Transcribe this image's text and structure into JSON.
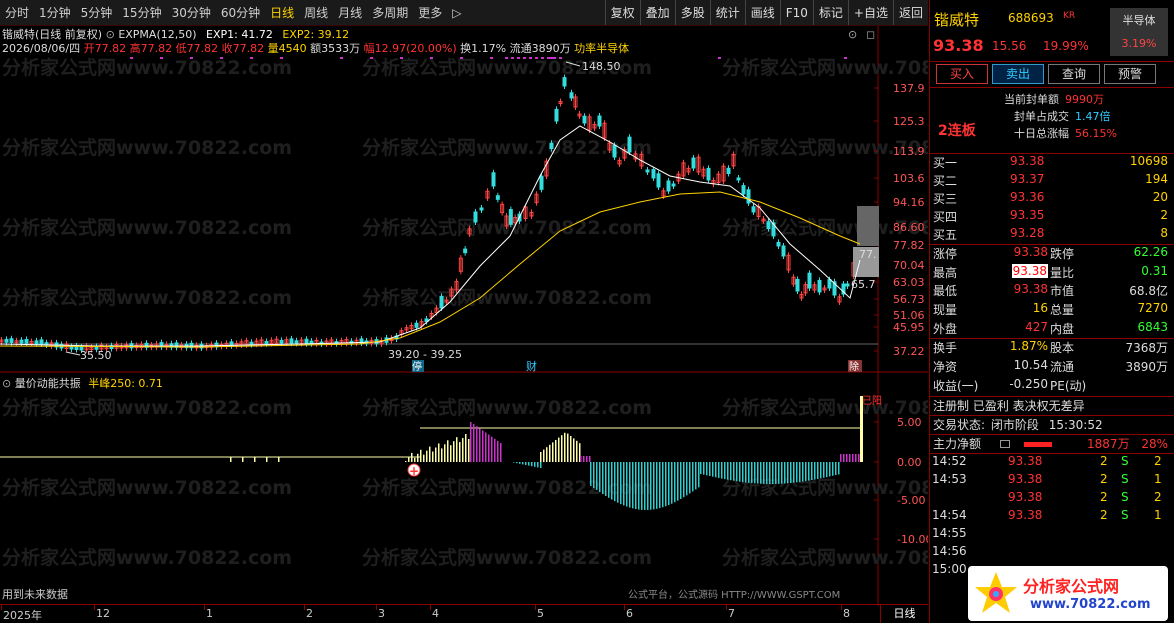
{
  "toolbar": {
    "periods": [
      "分时",
      "1分钟",
      "5分钟",
      "15分钟",
      "30分钟",
      "60分钟",
      "日线",
      "周线",
      "月线",
      "多周期",
      "更多"
    ],
    "active_index": 6,
    "more_arrow": "▷",
    "actions": [
      "复权",
      "叠加",
      "多股",
      "统计",
      "画线",
      "F10",
      "标记",
      "+自选",
      "返回"
    ]
  },
  "chart": {
    "title": "锴威特(日线 前复权)",
    "indicator": "EXPMA(12,50)",
    "exp1": "EXP1: 41.72",
    "exp2": "EXP2: 39.12",
    "date": "2026/08/06/四",
    "open": "开77.82",
    "high": "高77.82",
    "low": "低77.82",
    "close": "收77.82",
    "volume": "量4540",
    "amount": "额3533万",
    "range": "幅12.97(20.00%)",
    "turnover": "换1.17%",
    "float": "流通3890万",
    "sector": "功率半导体",
    "price_ticks": [
      "137.9",
      "125.3",
      "113.9",
      "103.6",
      "94.16",
      "86.60",
      "77.82",
      "70.04",
      "63.03",
      "56.73",
      "51.06",
      "45.95",
      "37.22"
    ],
    "annotations": {
      "high": "148.50",
      "low": "35.50",
      "range": "39.20 - 39.25",
      "last": "65.7",
      "box": "77."
    },
    "markers": {
      "ting": "停",
      "cai": "财",
      "ju": "除"
    },
    "watermark": "分析家公式网www.70822.com"
  },
  "sub": {
    "title": "量价动能共振",
    "label": "半峰250: 0.71",
    "ticks": [
      "5.00",
      "0.00",
      "-5.00",
      "-10.00"
    ],
    "corner": "已阳",
    "footer_left": "用到未来数据",
    "footer_center": "公式平台，公式源码 HTTP://WWW.GSPT.COM"
  },
  "date_axis": {
    "labels": [
      "2025年",
      "12",
      "1",
      "2",
      "3",
      "4",
      "5",
      "6",
      "7",
      "8"
    ],
    "tab": "日线"
  },
  "panel": {
    "name": "锴威特",
    "code": "688693",
    "market": "KR",
    "sector": "半导体",
    "sector_pct": "3.19%",
    "price": "93.38",
    "change": "15.56",
    "change_pct": "19.99%",
    "buttons": [
      "买入",
      "卖出",
      "查询",
      "预警"
    ],
    "board": "2连板",
    "seal": [
      {
        "label": "当前封单额",
        "value": "9990万",
        "color": "#ff3333"
      },
      {
        "label": "封单占成交",
        "value": "1.47倍",
        "color": "#33ccff"
      },
      {
        "label": "十日总涨幅",
        "value": "56.15%",
        "color": "#ff3333"
      }
    ],
    "orderbook": [
      {
        "label": "买一",
        "price": "93.38",
        "vol": "10698"
      },
      {
        "label": "买二",
        "price": "93.37",
        "vol": "194"
      },
      {
        "label": "买三",
        "price": "93.36",
        "vol": "20"
      },
      {
        "label": "买四",
        "price": "93.35",
        "vol": "2"
      },
      {
        "label": "买五",
        "price": "93.28",
        "vol": "8"
      }
    ],
    "stats": [
      {
        "a": "涨停",
        "av": "93.38",
        "avc": "#ff3333",
        "b": "跌停",
        "bv": "62.26",
        "bvc": "#33ff33"
      },
      {
        "a": "最高",
        "av": "93.38",
        "avc": "#ff3333",
        "b": "量比",
        "bv": "0.31",
        "bvc": "#33ff33",
        "hl": true
      },
      {
        "a": "最低",
        "av": "93.38",
        "avc": "#ff3333",
        "b": "市值",
        "bv": "68.8亿",
        "bvc": "#dddddd"
      },
      {
        "a": "现量",
        "av": "16",
        "avc": "#ffd200",
        "b": "总量",
        "bv": "7270",
        "bvc": "#ffd200"
      },
      {
        "a": "外盘",
        "av": "427",
        "avc": "#ff3333",
        "b": "内盘",
        "bv": "6843",
        "bvc": "#33ff33"
      }
    ],
    "stats2": [
      {
        "a": "换手",
        "av": "1.87%",
        "avc": "#ffd200",
        "b": "股本",
        "bv": "7368万",
        "bvc": "#dddddd"
      },
      {
        "a": "净资",
        "av": "10.54",
        "avc": "#dddddd",
        "b": "流通",
        "bv": "3890万",
        "bvc": "#dddddd"
      },
      {
        "a": "收益(一)",
        "av": "-0.250",
        "avc": "#dddddd",
        "b": "PE(动)",
        "bv": "",
        "bvc": "#dddddd"
      }
    ],
    "company": "注册制 已盈利 表决权无差异",
    "trade_state_label": "交易状态:",
    "trade_state": "闭市阶段",
    "trade_time": "15:30:52",
    "main_flow_label": "主力净额",
    "main_flow": "1887万",
    "main_flow_pct": "28%",
    "ticks": [
      {
        "t": "14:52",
        "p": "93.38",
        "q": "2",
        "s": "S",
        "n": "2"
      },
      {
        "t": "14:53",
        "p": "93.38",
        "q": "2",
        "s": "S",
        "n": "1"
      },
      {
        "t": "",
        "p": "93.38",
        "q": "2",
        "s": "S",
        "n": "2"
      },
      {
        "t": "14:54",
        "p": "93.38",
        "q": "2",
        "s": "S",
        "n": "1"
      },
      {
        "t": "14:55",
        "p": "",
        "q": "",
        "s": "",
        "n": ""
      },
      {
        "t": "14:56",
        "p": "",
        "q": "",
        "s": "",
        "n": ""
      },
      {
        "t": "15:00",
        "p": "",
        "q": "",
        "s": "",
        "n": ""
      }
    ],
    "logo_text": "分析家公式网",
    "logo_url": "www.70822.com"
  }
}
